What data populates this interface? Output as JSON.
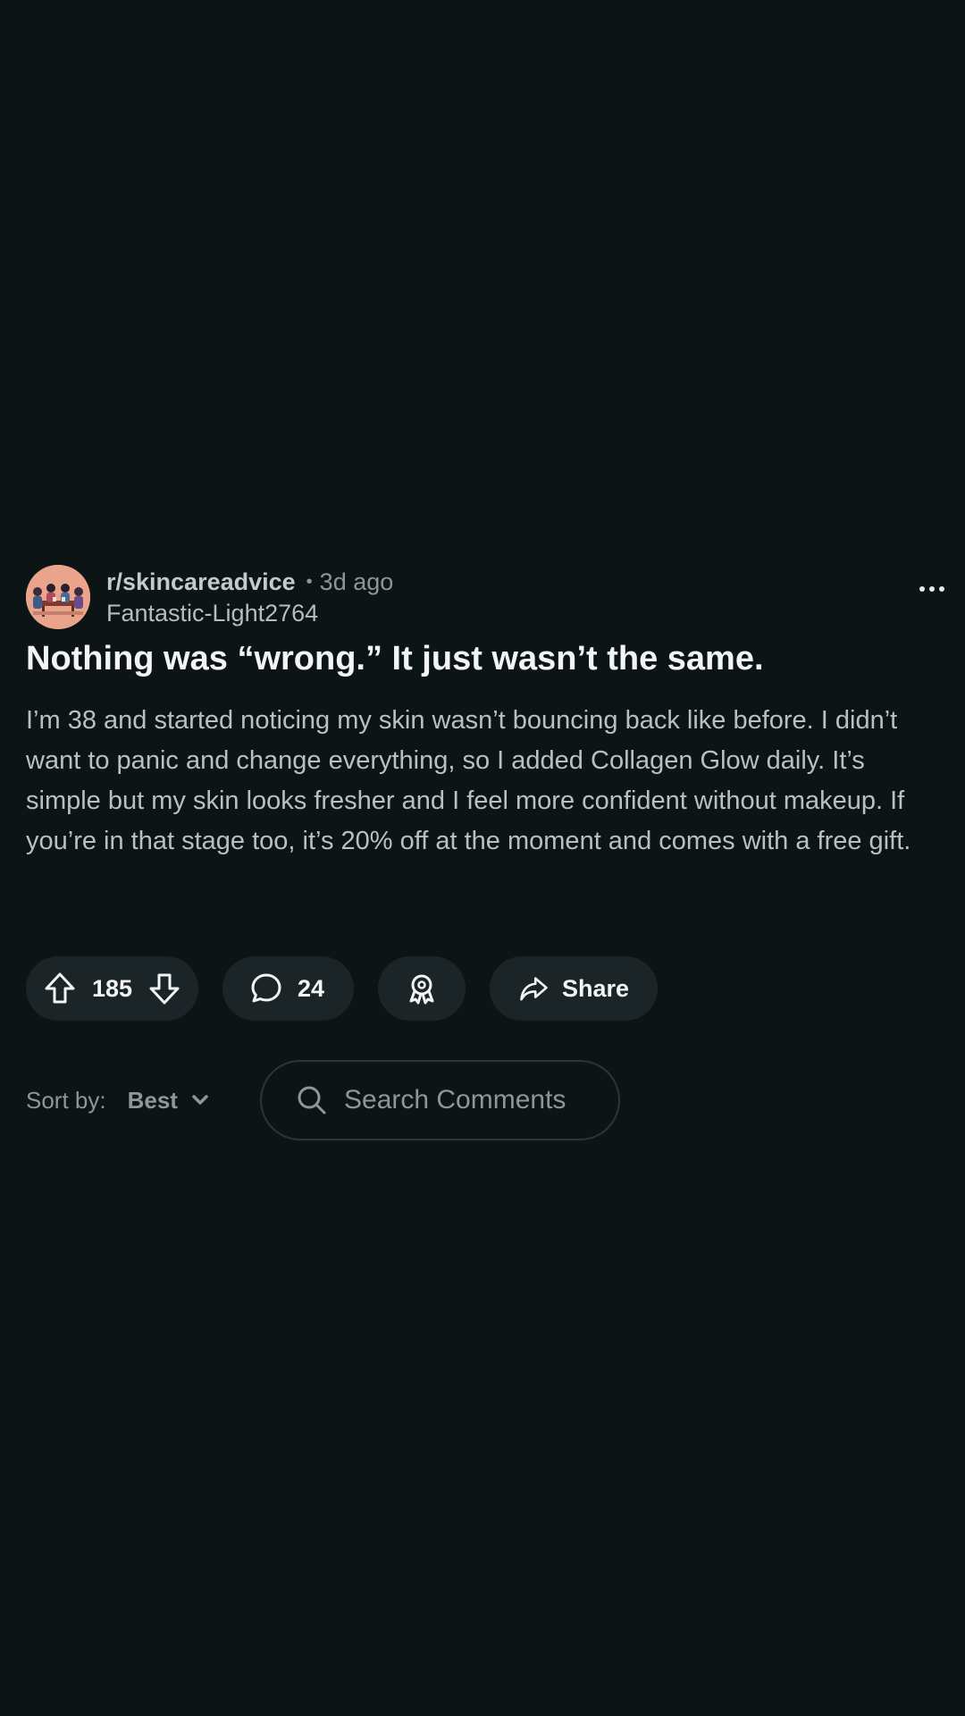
{
  "post": {
    "subreddit": "r/skincareadvice",
    "separator": "•",
    "time_ago": "3d ago",
    "author": "Fantastic-Light2764",
    "title": "Nothing was “wrong.” It just wasn’t the same.",
    "body": "I’m 38 and started noticing my skin wasn’t bouncing back like before. I didn’t want to panic and change everything, so I added Collagen Glow daily. It’s simple but my skin looks fresher and I feel more confident without makeup. If you’re in that stage too, it’s 20% off at the moment and comes with a free gift."
  },
  "actions": {
    "upvotes": "185",
    "comments": "24",
    "share_label": "Share"
  },
  "sort": {
    "label": "Sort by:",
    "value": "Best"
  },
  "search": {
    "placeholder": "Search Comments",
    "value": ""
  },
  "icons": {
    "upvote": "arrow-up-icon",
    "downvote": "arrow-down-icon",
    "comment": "speech-bubble-icon",
    "award": "award-ribbon-icon",
    "share": "share-arrow-icon",
    "sort_chevron": "chevron-down-icon",
    "search": "search-icon",
    "more": "more-horizontal-icon"
  },
  "colors": {
    "background": "#0d1416",
    "pill": "#1b2427",
    "muted_text": "#8c979c",
    "primary_text": "#f2f4f5"
  }
}
